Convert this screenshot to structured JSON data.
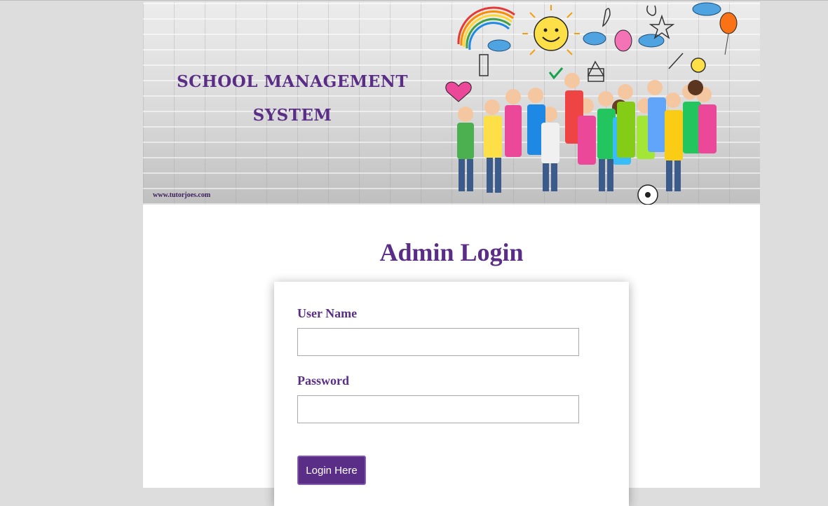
{
  "banner": {
    "title": "SCHOOL MANAGEMENT SYSTEM",
    "website": "www.tutorjoes.com"
  },
  "login": {
    "heading": "Admin Login",
    "username_label": "User Name",
    "username_value": "",
    "password_label": "Password",
    "password_value": "",
    "submit_label": "Login Here"
  },
  "colors": {
    "accent": "#5a2d86",
    "page_background": "#dddddd",
    "content_background": "#ffffff"
  }
}
